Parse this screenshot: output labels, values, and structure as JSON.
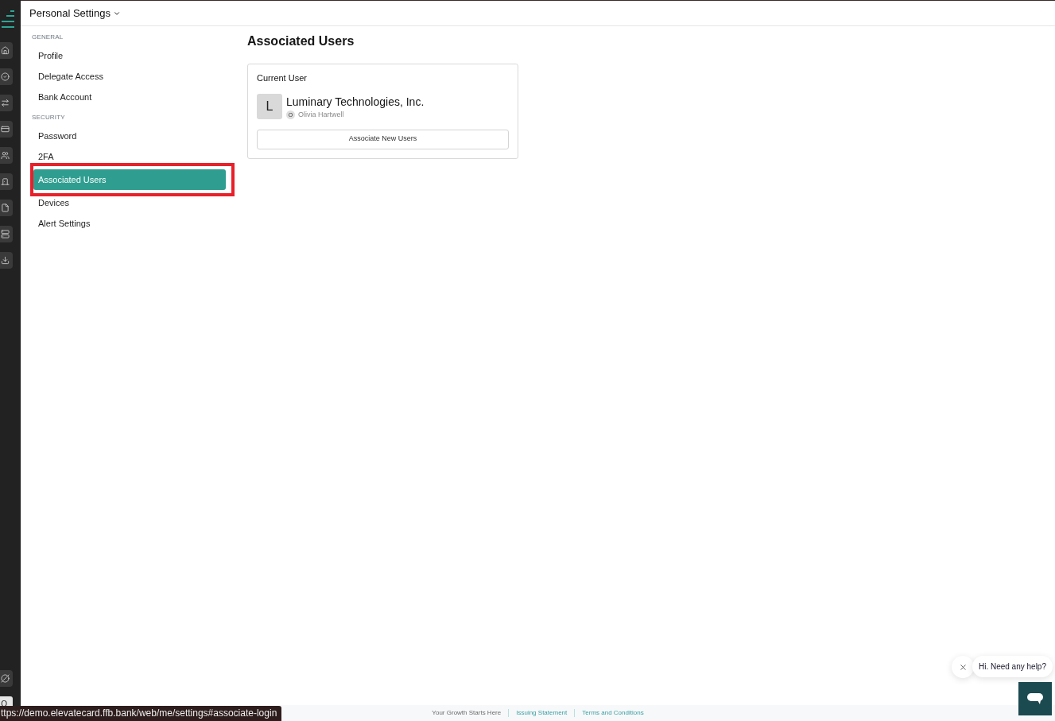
{
  "rail": {
    "avatar_letter": "O"
  },
  "header": {
    "title": "Personal Settings"
  },
  "settings_nav": {
    "sections": [
      {
        "heading": "GENERAL",
        "items": [
          {
            "label": "Profile",
            "selected": false
          },
          {
            "label": "Delegate Access",
            "selected": false
          },
          {
            "label": "Bank Account",
            "selected": false
          }
        ]
      },
      {
        "heading": "SECURITY",
        "items": [
          {
            "label": "Password",
            "selected": false
          },
          {
            "label": "2FA",
            "selected": false
          },
          {
            "label": "Associated Users",
            "selected": true
          },
          {
            "label": "Devices",
            "selected": false
          },
          {
            "label": "Alert Settings",
            "selected": false
          }
        ]
      }
    ]
  },
  "main": {
    "title": "Associated Users",
    "current_user_card": {
      "heading": "Current User",
      "avatar_letter": "L",
      "company": "Luminary Technologies, Inc.",
      "user_initial": "O",
      "user_name": "Olivia Hartwell",
      "button": "Associate New Users"
    }
  },
  "footer": {
    "links": [
      {
        "label": "Your Growth Starts Here",
        "kind": "text"
      },
      {
        "label": "Issuing Statement",
        "kind": "link"
      },
      {
        "label": "Terms and Conditions",
        "kind": "link"
      }
    ]
  },
  "status_url": "ttps://demo.elevatecard.ffb.bank/web/me/settings#associate-login",
  "chat": {
    "greeting": "Hi. Need any help?"
  }
}
